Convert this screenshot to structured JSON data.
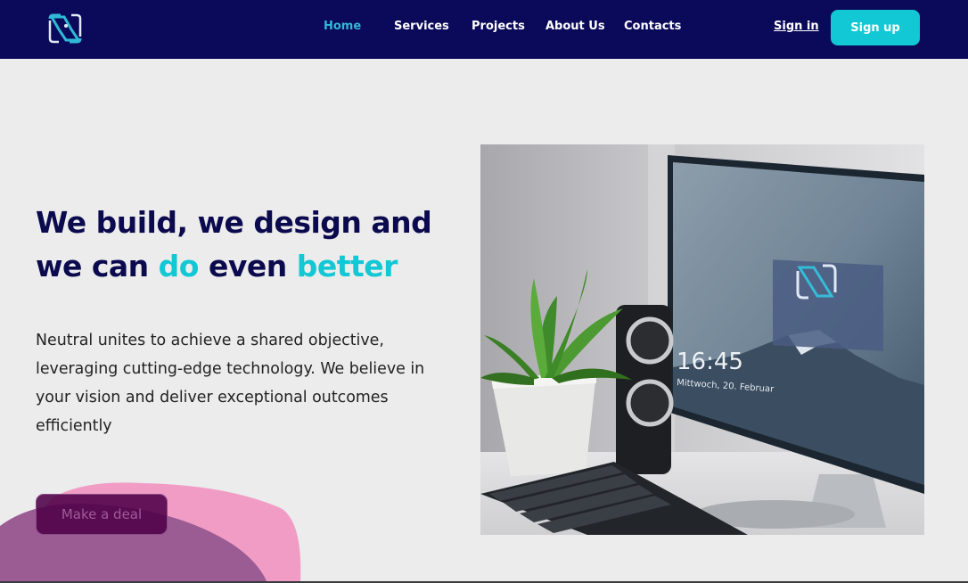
{
  "nav": {
    "items": [
      {
        "label": "Home",
        "active": true
      },
      {
        "label": "Services",
        "active": false
      },
      {
        "label": "Projects",
        "active": false
      },
      {
        "label": "About Us",
        "active": false
      },
      {
        "label": "Contacts",
        "active": false
      }
    ],
    "signin_label": "Sign in",
    "signup_label": "Sign up"
  },
  "hero": {
    "headline_line1": "We build, we design and",
    "headline_line2_a": "we can ",
    "headline_line2_b": "do",
    "headline_line2_c": " even ",
    "headline_line2_d": "better",
    "description": "Neutral unites to achieve a shared objective, leveraging cutting-edge technology. We believe in your vision and deliver exceptional outcomes efficiently",
    "cta_label": "Make a deal"
  },
  "screen": {
    "time": "16:45",
    "date": "Mittwoch, 20. Februar"
  },
  "colors": {
    "navbar": "#0b0a5a",
    "accent": "#12c8d4",
    "headline": "#0b0a4e",
    "active_nav": "#2fb9d6",
    "background": "#ececec"
  },
  "icons": {
    "logo": "brand-logo-icon"
  }
}
